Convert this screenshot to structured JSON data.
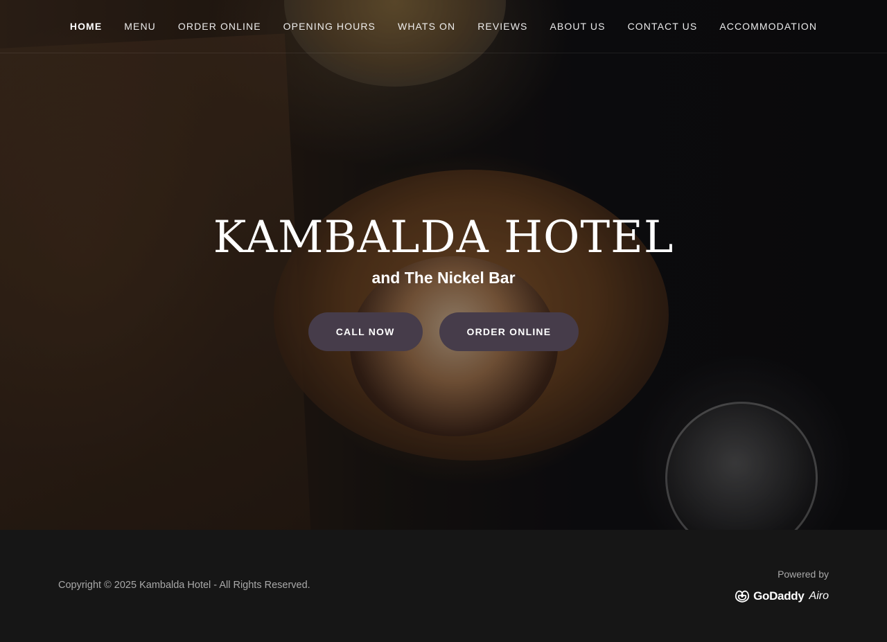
{
  "nav": {
    "items": [
      {
        "label": "HOME",
        "active": true
      },
      {
        "label": "MENU"
      },
      {
        "label": "ORDER ONLINE"
      },
      {
        "label": "OPENING HOURS"
      },
      {
        "label": "WHATS ON"
      },
      {
        "label": "REVIEWS"
      },
      {
        "label": "ABOUT US"
      },
      {
        "label": "CONTACT US"
      },
      {
        "label": "ACCOMMODATION"
      }
    ]
  },
  "hero": {
    "title": "KAMBALDA HOTEL",
    "subtitle": "and The Nickel Bar",
    "buttons": {
      "call": "CALL NOW",
      "order": "ORDER ONLINE"
    }
  },
  "footer": {
    "copyright": "Copyright © 2025 Kambalda Hotel - All Rights Reserved.",
    "powered_by": "Powered by",
    "brand_name": "GoDaddy",
    "brand_sub": "Airo"
  },
  "icons": {
    "brand_logo": "godaddy-logo-icon"
  },
  "colors": {
    "button_bg": "#463c4a",
    "footer_bg": "#161616",
    "footer_text": "#a9a9a9"
  }
}
